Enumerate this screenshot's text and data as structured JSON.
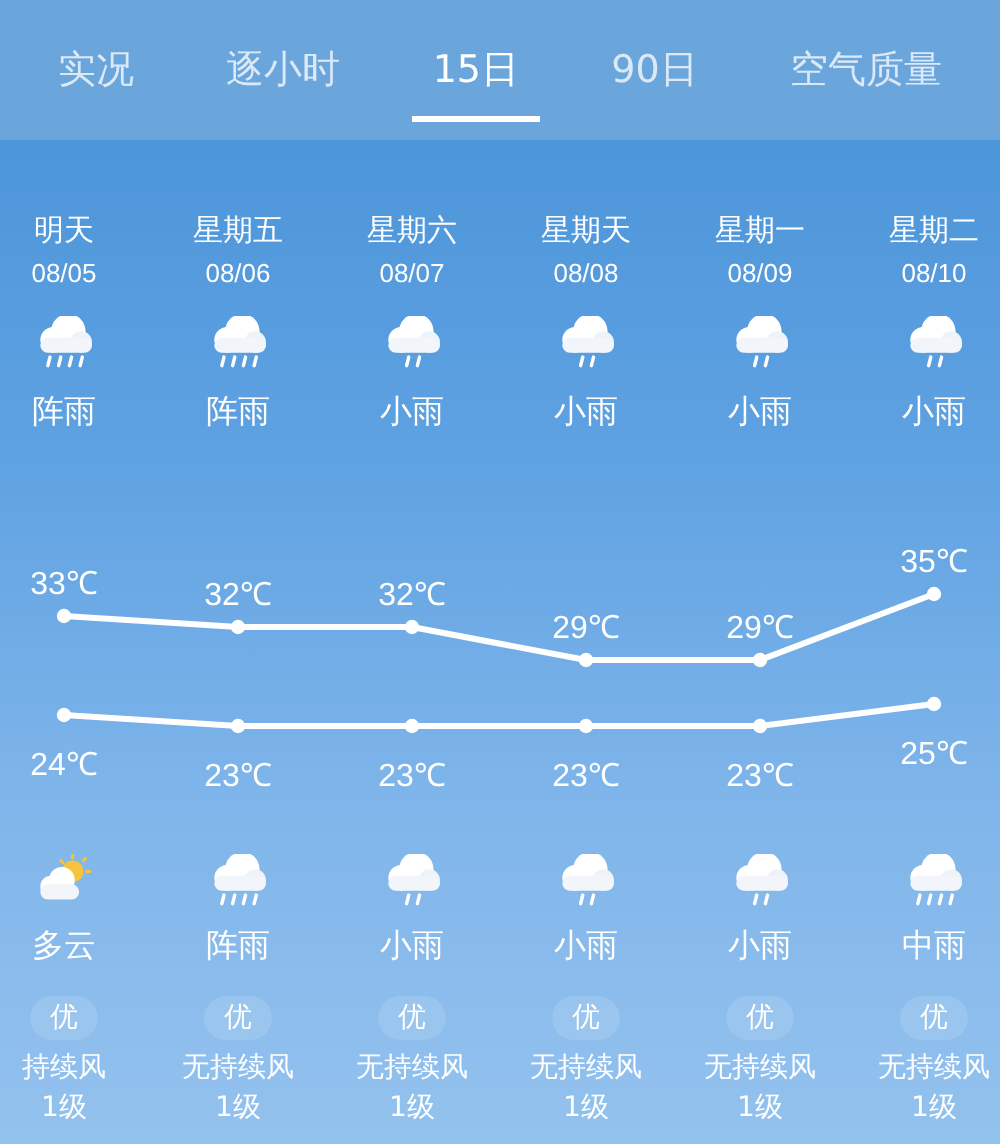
{
  "tabs": [
    {
      "label": "实况",
      "selected": false
    },
    {
      "label": "逐小时",
      "selected": false
    },
    {
      "label": "15日",
      "selected": true
    },
    {
      "label": "90日",
      "selected": false
    },
    {
      "label": "空气质量",
      "selected": false
    }
  ],
  "days": [
    {
      "name": "明天",
      "date": "08/05",
      "day": {
        "kind": "shower",
        "text": "阵雨"
      },
      "night": {
        "kind": "partly-cloudy",
        "text": "多云"
      },
      "aqi": "优",
      "wind": "持续风",
      "wind_level": "1级"
    },
    {
      "name": "星期五",
      "date": "08/06",
      "day": {
        "kind": "shower",
        "text": "阵雨"
      },
      "night": {
        "kind": "shower",
        "text": "阵雨"
      },
      "aqi": "优",
      "wind": "无持续风",
      "wind_level": "1级"
    },
    {
      "name": "星期六",
      "date": "08/07",
      "day": {
        "kind": "light-rain",
        "text": "小雨"
      },
      "night": {
        "kind": "light-rain",
        "text": "小雨"
      },
      "aqi": "优",
      "wind": "无持续风",
      "wind_level": "1级"
    },
    {
      "name": "星期天",
      "date": "08/08",
      "day": {
        "kind": "light-rain",
        "text": "小雨"
      },
      "night": {
        "kind": "light-rain",
        "text": "小雨"
      },
      "aqi": "优",
      "wind": "无持续风",
      "wind_level": "1级"
    },
    {
      "name": "星期一",
      "date": "08/09",
      "day": {
        "kind": "light-rain",
        "text": "小雨"
      },
      "night": {
        "kind": "light-rain",
        "text": "小雨"
      },
      "aqi": "优",
      "wind": "无持续风",
      "wind_level": "1级"
    },
    {
      "name": "星期二",
      "date": "08/10",
      "day": {
        "kind": "light-rain",
        "text": "小雨"
      },
      "night": {
        "kind": "moderate-rain",
        "text": "中雨"
      },
      "aqi": "优",
      "wind": "无持续风",
      "wind_level": "1级"
    }
  ],
  "temperature_chart": {
    "chart_data": {
      "type": "line",
      "categories": [
        null,
        null,
        null,
        null,
        null,
        null
      ],
      "series": [
        {
          "color": "#ffffff",
          "marker": "circle",
          "values": [
            33,
            32,
            32,
            29,
            29,
            35
          ],
          "value_labels": [
            "33℃",
            "32℃",
            "32℃",
            "29℃",
            "29℃",
            "35℃"
          ]
        },
        {
          "color": "#ffffff",
          "marker": "circle",
          "values": [
            24,
            23,
            23,
            23,
            23,
            25
          ],
          "value_labels": [
            "24℃",
            "23℃",
            "23℃",
            "23℃",
            "23℃",
            "25℃"
          ]
        }
      ],
      "data_labels": true
    }
  }
}
